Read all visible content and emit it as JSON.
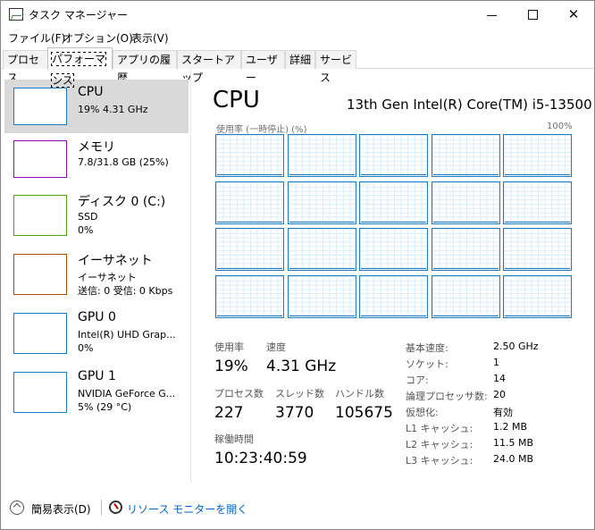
{
  "window": {
    "title": "タスク マネージャー",
    "controls": {
      "minimize": "",
      "maximize": "",
      "close": "✕"
    }
  },
  "menu": [
    "ファイル(F)",
    "オプション(O)",
    "表示(V)"
  ],
  "tabs": [
    "プロセス",
    "パフォーマンス",
    "アプリの履歴",
    "スタートアップ",
    "ユーザー",
    "詳細",
    "サービス"
  ],
  "active_tab": "パフォーマンス",
  "resources": [
    {
      "name": "CPU",
      "sub1": "19%  4.31 GHz",
      "sub2": "",
      "sub3": "",
      "border_color": "#1d7bbf",
      "selected": true
    },
    {
      "name": "メモリ",
      "sub1": "7.8/31.8 GB (25%)",
      "sub2": "",
      "sub3": "",
      "border_color": "#8b12ae"
    },
    {
      "name": "ディスク 0 (C:)",
      "sub1": "SSD",
      "sub2": "0%",
      "sub3": "",
      "border_color": "#4da60c"
    },
    {
      "name": "イーサネット",
      "sub1": "イーサネット",
      "sub2": "送信: 0 受信: 0 Kbps",
      "sub3": "",
      "border_color": "#a74f01"
    },
    {
      "name": "GPU 0",
      "sub1": "Intel(R) UHD Grap...",
      "sub2": "0%",
      "sub3": "",
      "border_color": "#1d7bbf"
    },
    {
      "name": "GPU 1",
      "sub1": "NVIDIA GeForce G...",
      "sub2": "5% (29 °C)",
      "sub3": "",
      "border_color": "#1d7bbf"
    }
  ],
  "detail": {
    "title": "CPU",
    "model": "13th Gen Intel(R) Core(TM) i5-13500",
    "graph_label": "使用率 (一時停止) (%)",
    "graph_max": "100%",
    "graph_count": 20,
    "graph_color": "#1d7bbf",
    "stats": {
      "usage_label": "使用率",
      "usage_value": "19%",
      "speed_label": "速度",
      "speed_value": "4.31 GHz",
      "processes_label": "プロセス数",
      "processes_value": "227",
      "threads_label": "スレッド数",
      "threads_value": "3770",
      "handles_label": "ハンドル数",
      "handles_value": "105675",
      "uptime_label": "稼働時間",
      "uptime_value": "10:23:40:59"
    },
    "specs": [
      {
        "label": "基本速度:",
        "value": "2.50 GHz"
      },
      {
        "label": "ソケット:",
        "value": "1"
      },
      {
        "label": "コア:",
        "value": "14"
      },
      {
        "label": "論理プロセッサ数:",
        "value": "20"
      },
      {
        "label": "仮想化:",
        "value": "有効"
      },
      {
        "label": "L1 キャッシュ:",
        "value": "1.2 MB"
      },
      {
        "label": "L2 キャッシュ:",
        "value": "11.5 MB"
      },
      {
        "label": "L3 キャッシュ:",
        "value": "24.0 MB"
      }
    ]
  },
  "footer": {
    "fewer_details": "簡易表示(D)",
    "resource_monitor": "リソース モニターを開く"
  }
}
